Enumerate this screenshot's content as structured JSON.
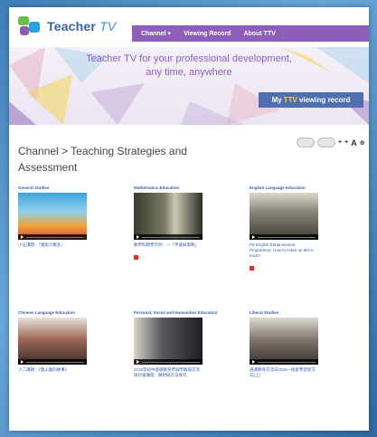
{
  "logo": {
    "name_a": "Teacher",
    "name_b": "TV"
  },
  "nav": [
    "Channel ▾",
    "Viewing Record",
    "About TTV"
  ],
  "banner": {
    "tagline_line1": "Teacher TV for your professional development,",
    "tagline_line2": "any time, anywhere",
    "record_prefix": "My",
    "record_ttv": "TTV",
    "record_suffix": "viewing record"
  },
  "breadcrumb": "Channel > Teaching Strategies and Assessment",
  "tools": {
    "small_a": "A",
    "large_a": "A",
    "plus": "+",
    "minus": "+"
  },
  "videos": [
    {
      "category": "General Studies",
      "title": "小五課題：「我能冷無多」",
      "has_pdf": false
    },
    {
      "category": "Mathematics Education",
      "title": "數學科教學示例：一「矛盾與策略」",
      "has_pdf": true
    },
    {
      "category": "English Language Education",
      "title": "P6 English Enhancement Programme: How to make an IBA e-book?",
      "has_pdf": true
    },
    {
      "category": "Chinese Language Education",
      "title": "小二課題：《螢火蟲的故事》",
      "has_pdf": false
    },
    {
      "category": "Personal, Social and Humanities Education",
      "title": "2015年初中基礎教育學與學教與交流研討會講座：題材與方法探究",
      "has_pdf": false
    },
    {
      "category": "Liberal Studies",
      "title": "通識教育交流日2016—探索學習新方向(上)",
      "has_pdf": false
    }
  ],
  "colors": {
    "nav": "#8e5fb8",
    "button": "#4f6fb0",
    "link": "#3a5ca8"
  }
}
